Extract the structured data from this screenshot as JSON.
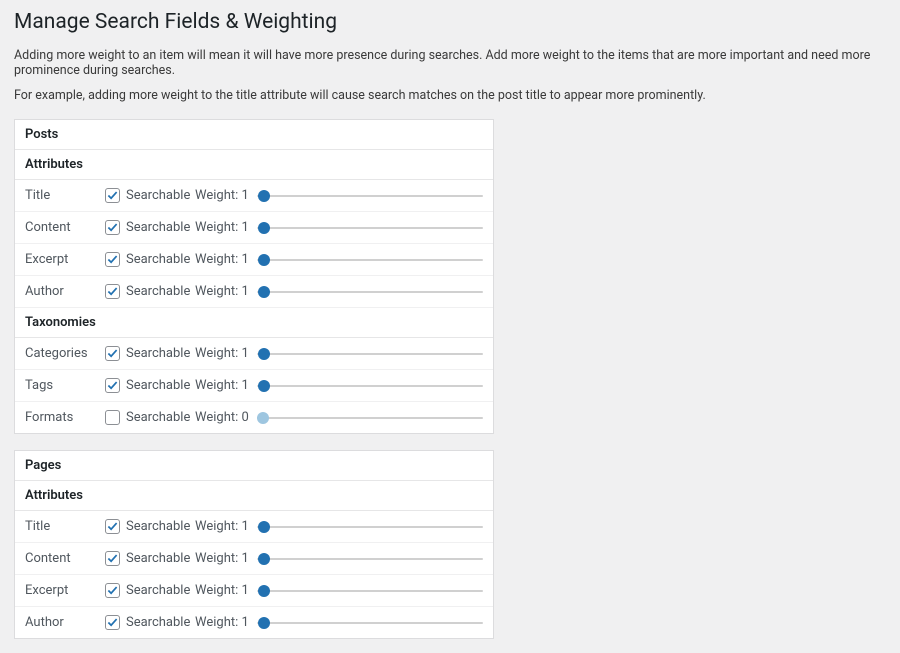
{
  "page": {
    "title": "Manage Search Fields & Weighting",
    "intro1": "Adding more weight to an item will mean it will have more presence during searches. Add more weight to the items that are more important and need more prominence during searches.",
    "intro2": "For example, adding more weight to the title attribute will cause search matches on the post title to appear more prominently."
  },
  "labels": {
    "searchable": "Searchable",
    "weight_prefix": "Weight:"
  },
  "slider": {
    "max": 100
  },
  "panels": [
    {
      "title": "Posts",
      "groups": [
        {
          "title": "Attributes",
          "rows": [
            {
              "label": "Title",
              "searchable": true,
              "weight": 1
            },
            {
              "label": "Content",
              "searchable": true,
              "weight": 1
            },
            {
              "label": "Excerpt",
              "searchable": true,
              "weight": 1
            },
            {
              "label": "Author",
              "searchable": true,
              "weight": 1
            }
          ]
        },
        {
          "title": "Taxonomies",
          "rows": [
            {
              "label": "Categories",
              "searchable": true,
              "weight": 1
            },
            {
              "label": "Tags",
              "searchable": true,
              "weight": 1
            },
            {
              "label": "Formats",
              "searchable": false,
              "weight": 0
            }
          ]
        }
      ]
    },
    {
      "title": "Pages",
      "groups": [
        {
          "title": "Attributes",
          "rows": [
            {
              "label": "Title",
              "searchable": true,
              "weight": 1
            },
            {
              "label": "Content",
              "searchable": true,
              "weight": 1
            },
            {
              "label": "Excerpt",
              "searchable": true,
              "weight": 1
            },
            {
              "label": "Author",
              "searchable": true,
              "weight": 1
            }
          ]
        }
      ]
    }
  ]
}
